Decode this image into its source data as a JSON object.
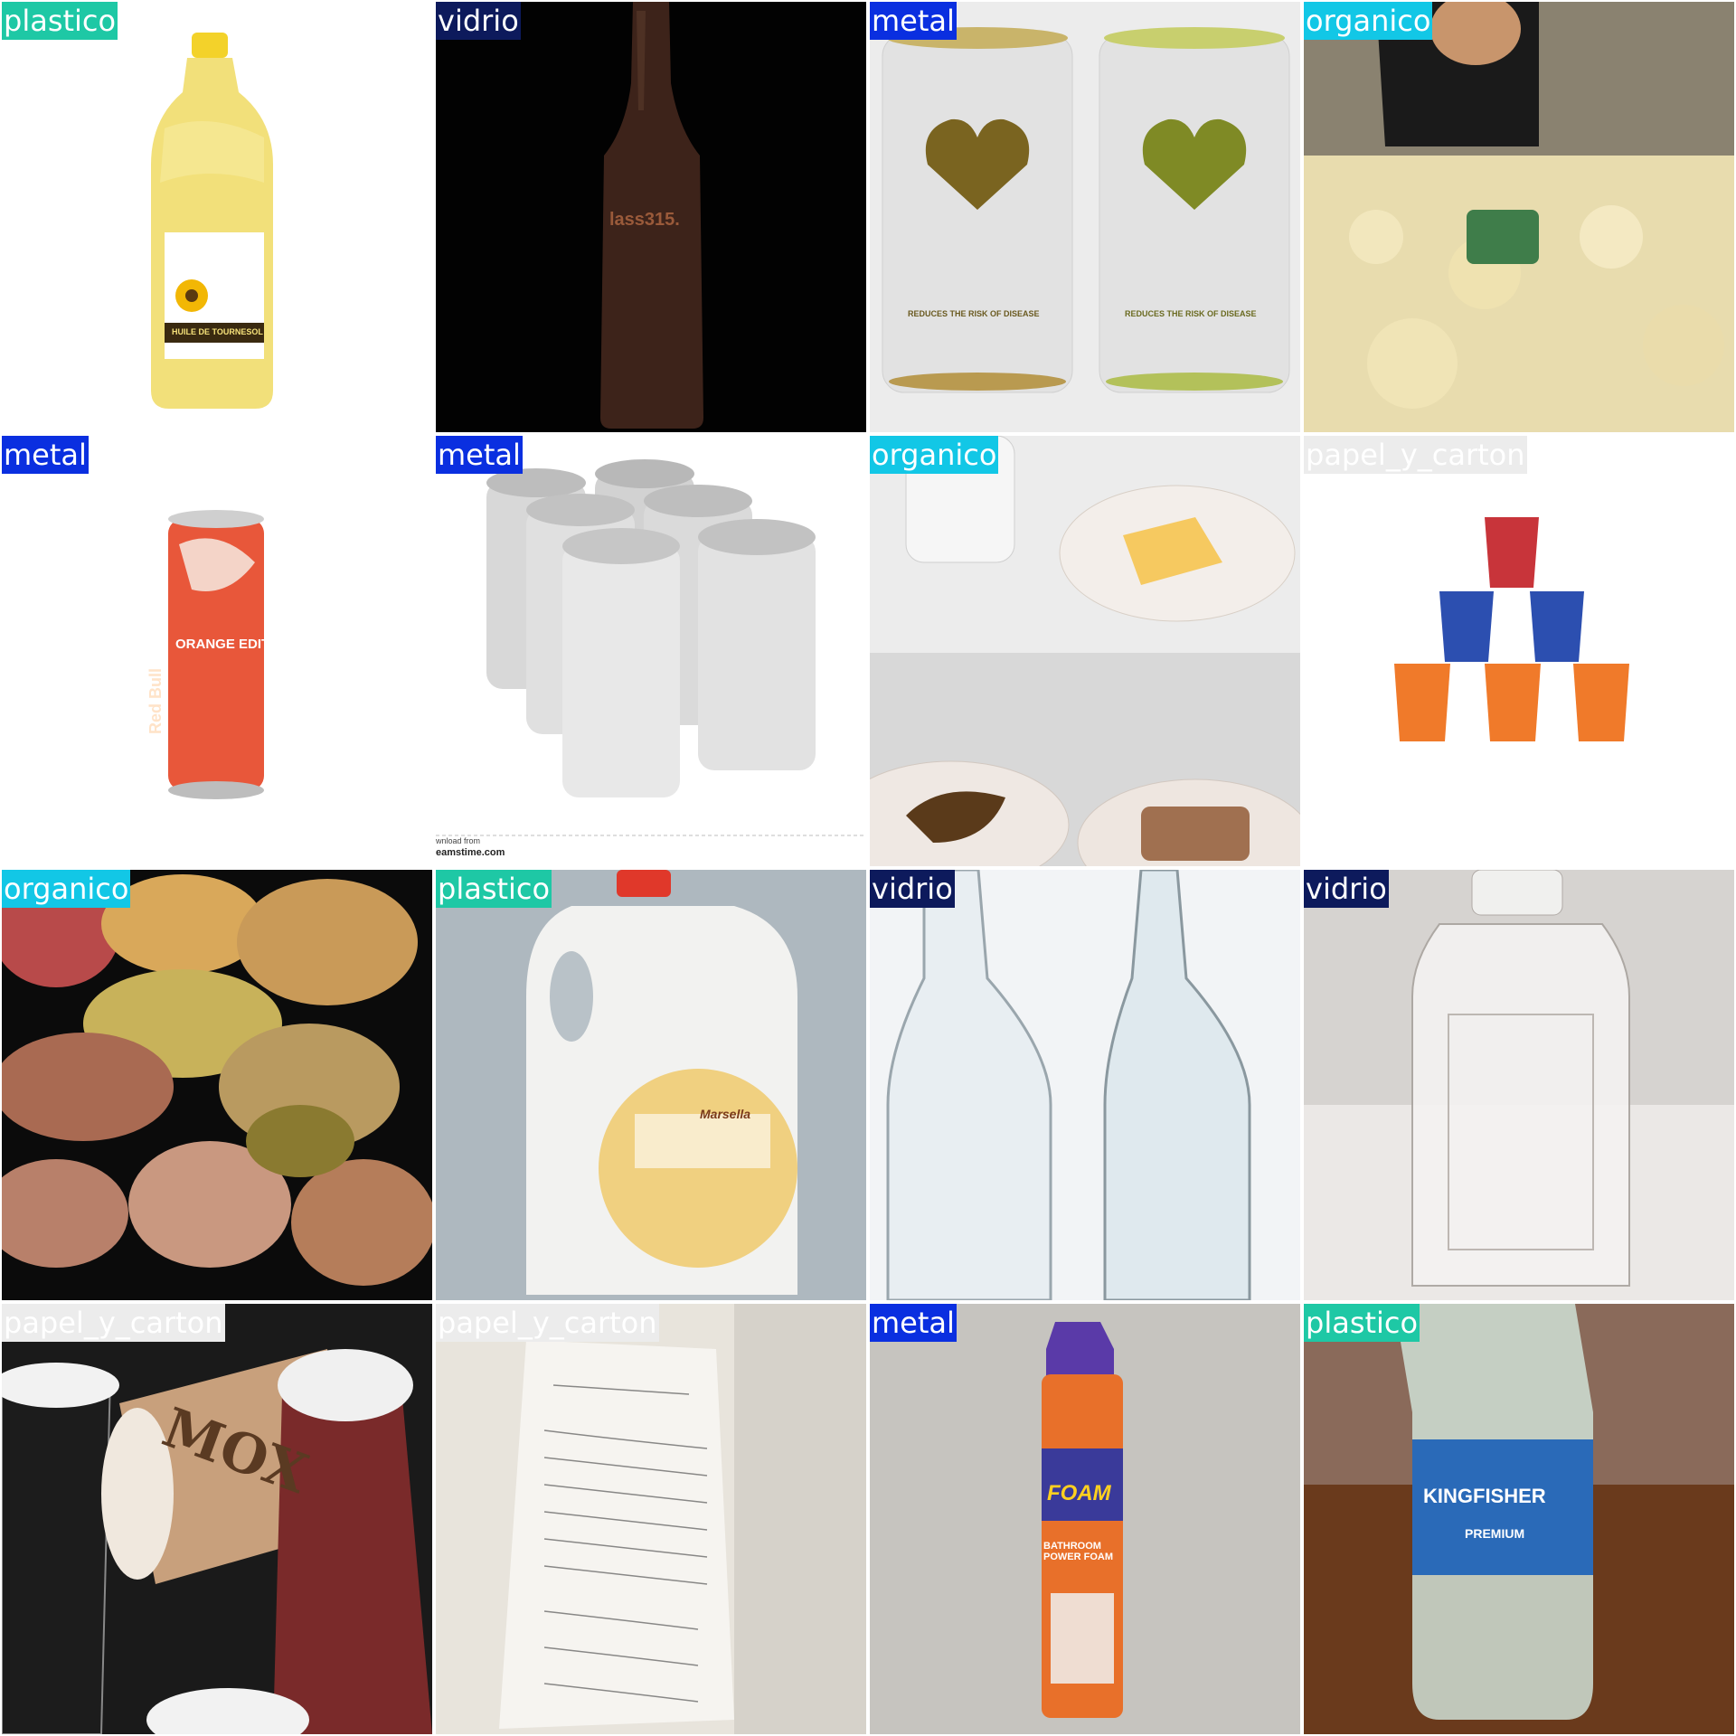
{
  "grid": {
    "tiles": [
      {
        "label": "plastico",
        "bg": "#ffffff",
        "label_bg": "#1ec8a5",
        "label_color": "#ffffff"
      },
      {
        "label": "vidrio",
        "bg": "#020202",
        "label_bg": "#0d1a5c",
        "label_color": "#ffffff"
      },
      {
        "label": "metal",
        "bg": "#ececec",
        "label_bg": "#0a2fe0",
        "label_color": "#ffffff"
      },
      {
        "label": "organico",
        "bg": "#c9c2a8",
        "label_bg": "#12c7e6",
        "label_color": "#ffffff"
      },
      {
        "label": "metal",
        "bg": "#ffffff",
        "label_bg": "#0a2fe0",
        "label_color": "#ffffff"
      },
      {
        "label": "metal",
        "bg": "#ffffff",
        "label_bg": "#0a2fe0",
        "label_color": "#ffffff"
      },
      {
        "label": "organico",
        "bg": "#dcdcdc",
        "label_bg": "#12c7e6",
        "label_color": "#ffffff"
      },
      {
        "label": "papel_y_carton",
        "bg": "#ffffff",
        "label_bg": "#ececec",
        "label_color": "#ffffff"
      },
      {
        "label": "organico",
        "bg": "#0b0b0b",
        "label_bg": "#12c7e6",
        "label_color": "#ffffff"
      },
      {
        "label": "plastico",
        "bg": "#b9c2c8",
        "label_bg": "#1ec8a5",
        "label_color": "#ffffff"
      },
      {
        "label": "vidrio",
        "bg": "#f2f4f6",
        "label_bg": "#0d1a5c",
        "label_color": "#ffffff"
      },
      {
        "label": "vidrio",
        "bg": "#e6e4e2",
        "label_bg": "#0d1a5c",
        "label_color": "#ffffff"
      },
      {
        "label": "papel_y_carton",
        "bg": "#1a1a1a",
        "label_bg": "#ececec",
        "label_color": "#ffffff"
      },
      {
        "label": "papel_y_carton",
        "bg": "#e9e6e0",
        "label_bg": "#ececec",
        "label_color": "#ffffff"
      },
      {
        "label": "metal",
        "bg": "#c8c6c2",
        "label_bg": "#0a2fe0",
        "label_color": "#ffffff"
      },
      {
        "label": "plastico",
        "bg": "#6b3a1c",
        "label_bg": "#1ec8a5",
        "label_color": "#ffffff"
      }
    ]
  },
  "product_text": {
    "oil_bottle": "HUILE DE TOURNESOL",
    "glass_bottle": "lass315.",
    "beer_can_1": "REDUCES THE RISK OF DISEASE",
    "beer_can_2": "REDUCES THE RISK OF DISEASE",
    "energy_drink": "Red Bull",
    "energy_drink_edition": "ORANGE EDITION",
    "stock_watermark": "eamstime.com",
    "stock_download": "wnload from",
    "detergent_label": "Marsella",
    "coffee_cup_brand": "MOX",
    "spray_brand": "FOAM",
    "spray_product": "BATHROOM POWER FOAM",
    "water_brand": "KINGFISHER",
    "water_premium": "PREMIUM"
  }
}
